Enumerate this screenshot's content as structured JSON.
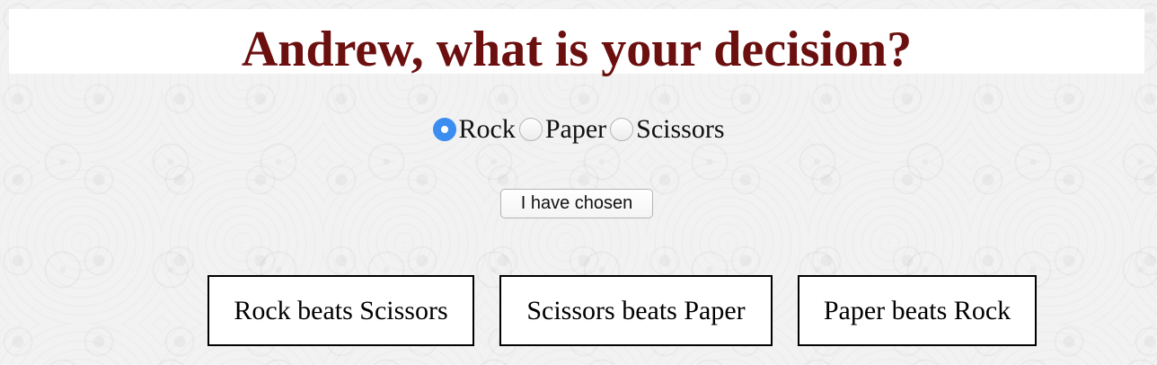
{
  "header": {
    "title": "Andrew, what is your decision?"
  },
  "choices": [
    {
      "label": "Rock",
      "selected": true
    },
    {
      "label": "Paper",
      "selected": false
    },
    {
      "label": "Scissors",
      "selected": false
    }
  ],
  "submit": {
    "label": "I have chosen"
  },
  "rules": [
    "Rock beats Scissors",
    "Scissors beats Paper",
    "Paper beats Rock"
  ],
  "colors": {
    "title": "#6b0f0f",
    "radio_selected": "#3b8ef0"
  }
}
